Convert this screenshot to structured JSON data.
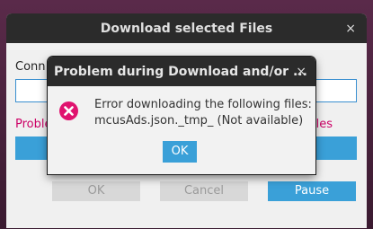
{
  "main_window": {
    "title": "Download selected Files",
    "close_glyph": "×",
    "connection_label": "Conn",
    "problem_left": "Proble",
    "problem_right": "iles",
    "buttons": {
      "ok": "OK",
      "cancel": "Cancel",
      "pause": "Pause"
    }
  },
  "dialog": {
    "title": "Problem during Download and/or ...",
    "close_glyph": "×",
    "message_line1": "Error downloading the following files:",
    "message_line2": "mcusAds.json._tmp_ (Not available)",
    "ok_label": "OK",
    "icon": "error-icon"
  },
  "colors": {
    "accent": "#3aa0d8",
    "error": "#e0136f",
    "titlebar": "#2b2b2b",
    "problem_text": "#cc0066"
  }
}
